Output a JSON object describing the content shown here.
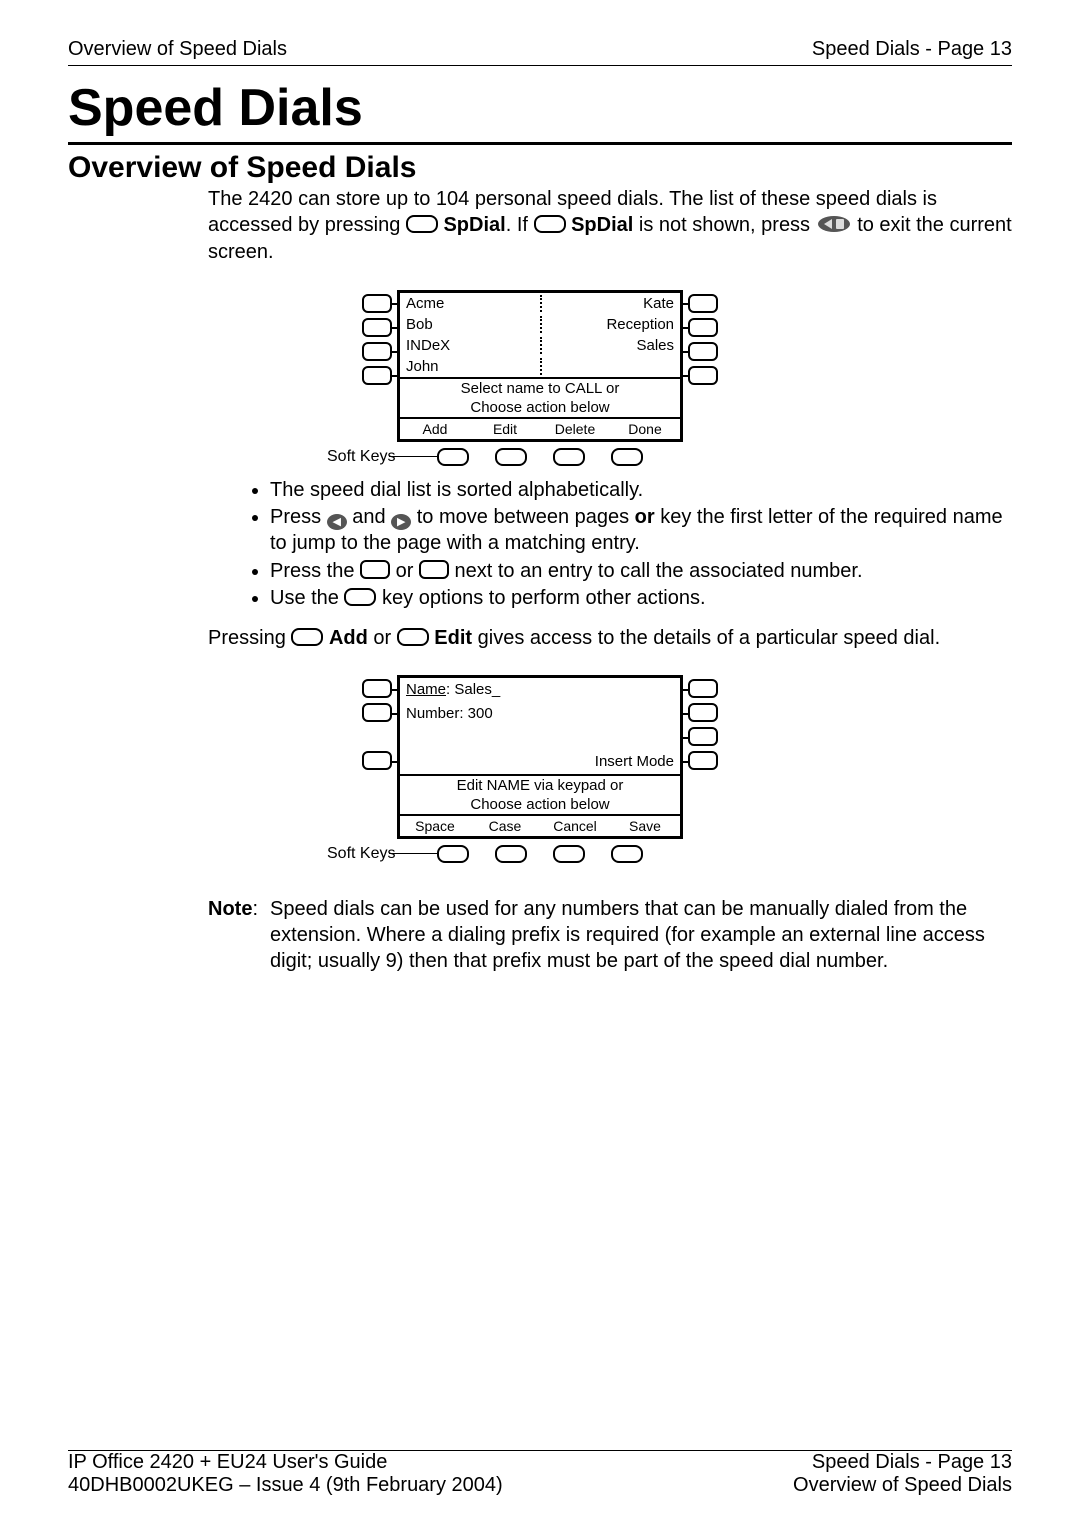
{
  "header": {
    "left": "Overview of Speed Dials",
    "right": "Speed Dials - Page 13"
  },
  "title": "Speed Dials",
  "section_title": "Overview of Speed Dials",
  "intro": {
    "part1": "The 2420 can store up to 104 personal speed dials. The list of these speed dials is accessed by pressing ",
    "spdial1": "SpDial",
    "part2": ". If ",
    "spdial2": "SpDial",
    "part3": " is not shown, press ",
    "part4": " to exit the current screen."
  },
  "diagram1": {
    "softkeys_label": "Soft Keys",
    "rows": [
      {
        "l": "Acme",
        "r": "Kate"
      },
      {
        "l": "Bob",
        "r": "Reception"
      },
      {
        "l": "INDeX",
        "r": "Sales"
      },
      {
        "l": "John",
        "r": ""
      }
    ],
    "msg1": "Select name to CALL or",
    "msg2": "Choose action below",
    "softkeys": [
      "Add",
      "Edit",
      "Delete",
      "Done"
    ]
  },
  "bullets": {
    "b1": "The speed dial list is sorted alphabetically.",
    "b2a": "Press ",
    "b2b": " and ",
    "b2c": " to move between pages ",
    "b2or": "or",
    "b2d": " key the first letter of the required name to jump to the page with a matching entry.",
    "b3a": "Press the ",
    "b3b": " or ",
    "b3c": " next to an entry to call the associated number.",
    "b4a": "Use the ",
    "b4b": " key options to perform other actions."
  },
  "mid": {
    "p1": "Pressing ",
    "add": "Add",
    "p2": " or ",
    "edit": "Edit",
    "p3": " gives access to the details of a particular speed dial."
  },
  "diagram2": {
    "softkeys_label": "Soft Keys",
    "name_label": "Name",
    "name_value": ": Sales_",
    "number": "Number: 300",
    "mode": "Insert Mode",
    "msg1": "Edit NAME via keypad or",
    "msg2": "Choose action below",
    "softkeys": [
      "Space",
      "Case",
      "Cancel",
      "Save"
    ]
  },
  "note": {
    "label": "Note",
    "text": "Speed dials can be used for any numbers that can be manually dialed from the extension. Where a dialing prefix is required (for example an external line access digit; usually 9) then that prefix must be part of the speed dial number."
  },
  "footer": {
    "left1": "IP Office 2420 + EU24 User's Guide",
    "left2": "40DHB0002UKEG – Issue 4 (9th February 2004)",
    "right1": "Speed Dials - Page 13",
    "right2": "Overview of Speed Dials"
  }
}
